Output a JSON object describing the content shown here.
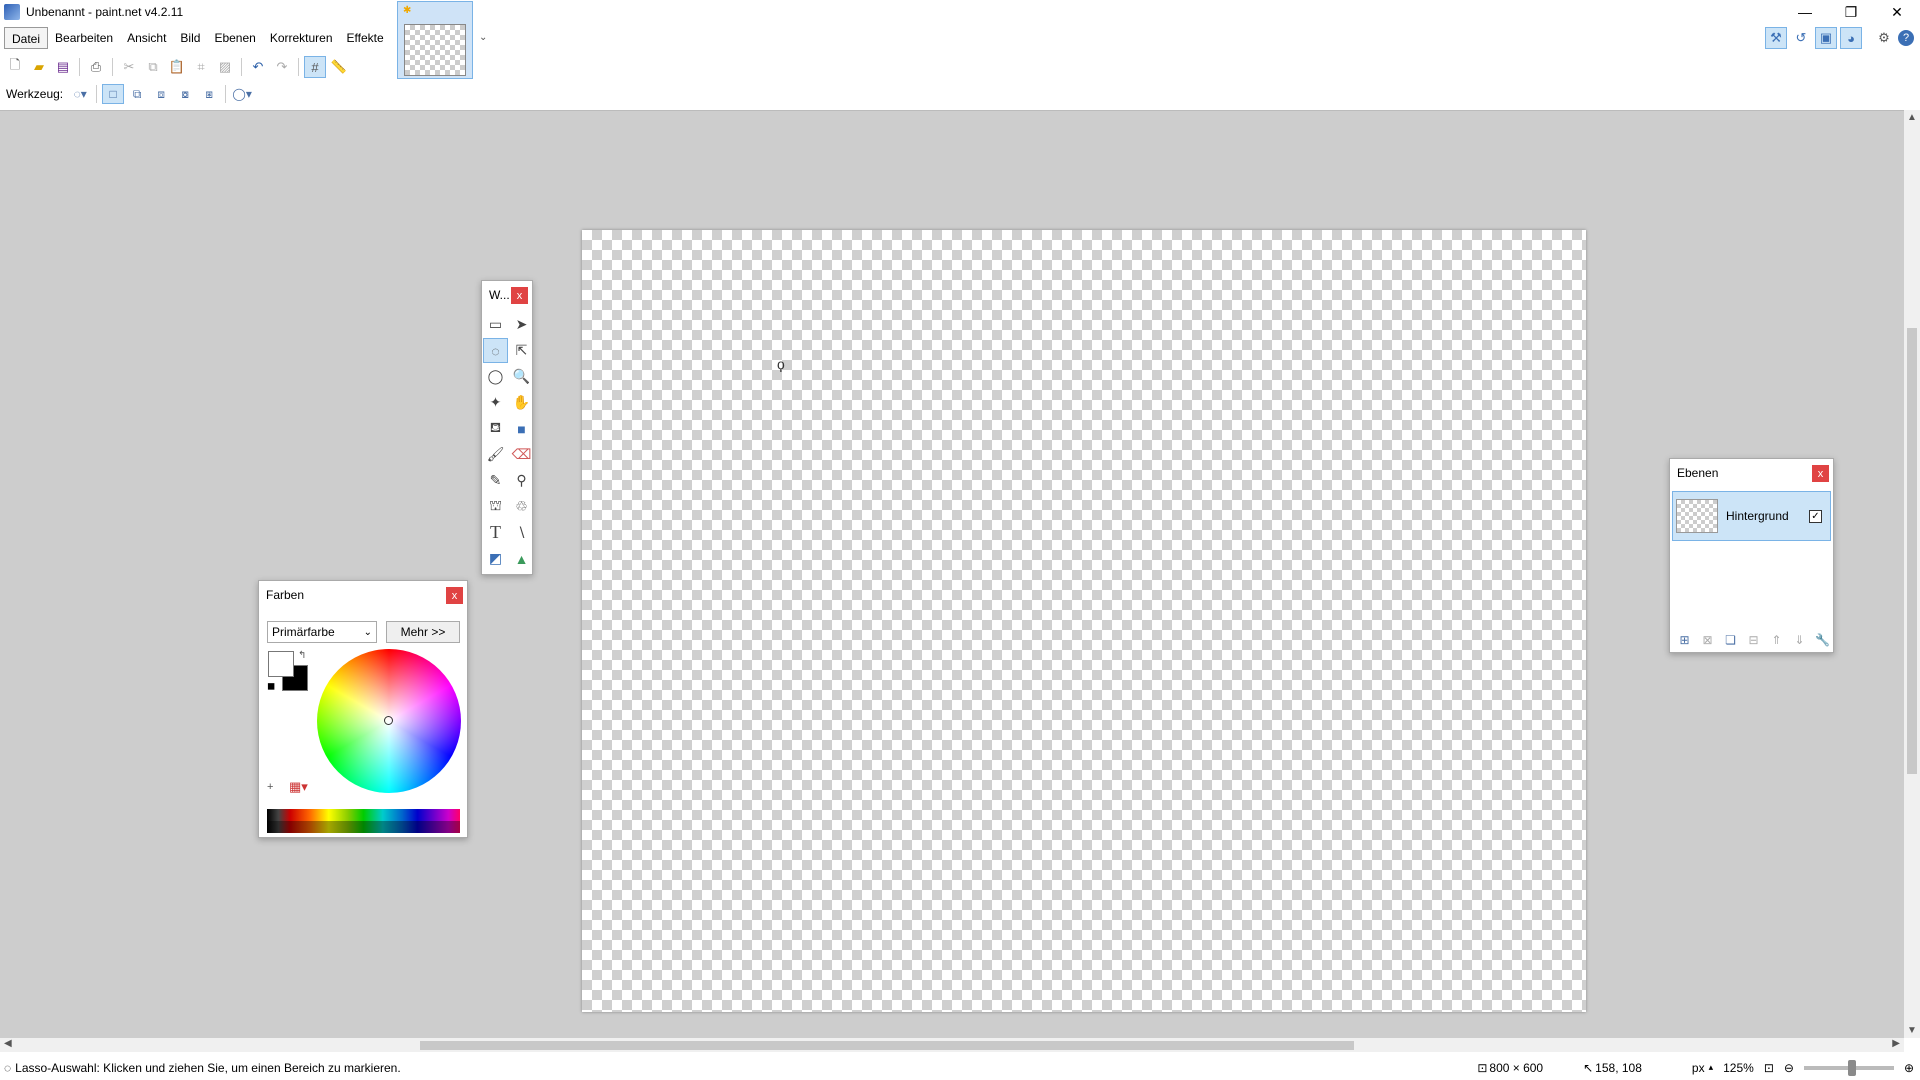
{
  "window": {
    "title": "Unbenannt - paint.net v4.2.11",
    "minimize_glyph": "—",
    "restore_glyph": "❐",
    "close_glyph": "✕"
  },
  "menu": {
    "items": [
      "Datei",
      "Bearbeiten",
      "Ansicht",
      "Bild",
      "Ebenen",
      "Korrekturen",
      "Effekte"
    ]
  },
  "toolbar": {
    "tool_label": "Werkzeug:",
    "icons": [
      "new-icon",
      "open-icon",
      "save-icon",
      "print-icon",
      "cut-icon",
      "copy-icon",
      "paste-icon",
      "crop-icon",
      "deselect-icon",
      "undo-icon",
      "redo-icon",
      "grid-icon",
      "ruler-icon"
    ]
  },
  "tools_window": {
    "title": "W...",
    "close": "x"
  },
  "colors_window": {
    "title": "Farben",
    "close": "x",
    "mode_select": "Primärfarbe",
    "more_button": "Mehr >>",
    "primary_color": "#ffffff",
    "secondary_color": "#000000"
  },
  "layers_window": {
    "title": "Ebenen",
    "close": "x",
    "layers": [
      {
        "name": "Hintergrund",
        "visible": true
      }
    ]
  },
  "status": {
    "message": "Lasso-Auswahl: Klicken und ziehen Sie, um einen Bereich zu markieren.",
    "image_size": "800 × 600",
    "cursor_position": "158, 108",
    "units": "px",
    "zoom": "125%"
  },
  "colors": {
    "accent": "#cce4f7",
    "accent_border": "#7ab3e6",
    "close_red": "#e04343",
    "workspace": "#cdcdcd"
  }
}
